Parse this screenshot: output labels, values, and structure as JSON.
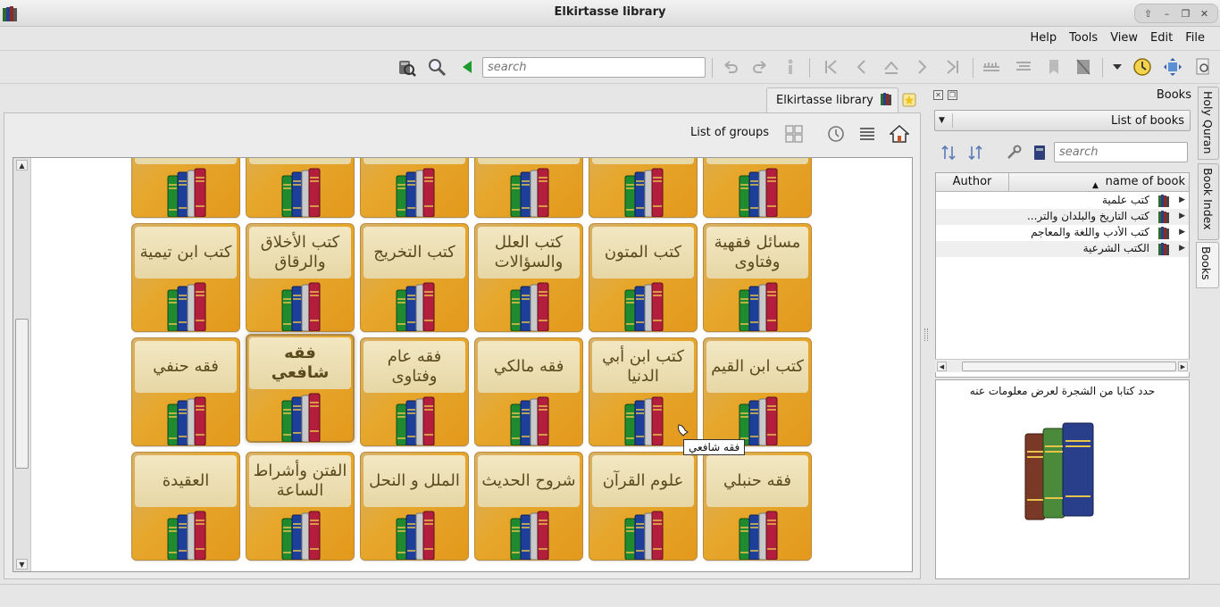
{
  "window": {
    "title": "Elkirtasse library"
  },
  "menu": {
    "file": "File",
    "edit": "Edit",
    "view": "View",
    "tools": "Tools",
    "help": "Help"
  },
  "toolbar": {
    "search_placeholder": "search"
  },
  "tab": {
    "label": "Elkirtasse library"
  },
  "groups_header": {
    "label": "List of groups"
  },
  "tiles": [
    {
      "label": "..."
    },
    {
      "label": "..."
    },
    {
      "label": "..."
    },
    {
      "label": "..."
    },
    {
      "label": "..."
    },
    {
      "label": "..."
    },
    {
      "label": "مسائل فقهية وفتاوى"
    },
    {
      "label": "كتب المتون"
    },
    {
      "label": "كتب العلل والسؤالات"
    },
    {
      "label": "كتب التخريج"
    },
    {
      "label": "كتب الأخلاق والرقاق"
    },
    {
      "label": "كتب ابن تيمية"
    },
    {
      "label": "كتب ابن القيم"
    },
    {
      "label": "كتب ابن أبي الدنيا"
    },
    {
      "label": "فقه مالكي"
    },
    {
      "label": "فقه عام وفتاوى"
    },
    {
      "label": "فقه شافعي"
    },
    {
      "label": "فقه حنفي"
    },
    {
      "label": "فقه حنبلي"
    },
    {
      "label": "علوم القرآن"
    },
    {
      "label": "شروح الحديث"
    },
    {
      "label": "الملل و النحل"
    },
    {
      "label": "الفتن وأشراط الساعة"
    },
    {
      "label": "العقيدة"
    }
  ],
  "tooltip": "فقه شافعي",
  "books_panel": {
    "title": "Books",
    "combo_value": "List of books",
    "search_placeholder": "search",
    "col_author": "Author",
    "col_name": "name of book",
    "rows": [
      {
        "label": "كتب علمية"
      },
      {
        "label": "كتب التاريخ والبلدان والتر..."
      },
      {
        "label": "كتب الأدب واللغة والمعاجم"
      },
      {
        "label": "الكتب الشرعية"
      }
    ],
    "info_message": "حدد كتابا من الشجرة لعرض معلومات عنه"
  },
  "side_tabs": {
    "quran": "Holy Quran",
    "index": "Book Index",
    "books": "Books"
  },
  "colors": {
    "tile_orange": "#e3991c",
    "tile_label": "#f2e7c2",
    "accent_green": "#1a9d2b"
  }
}
